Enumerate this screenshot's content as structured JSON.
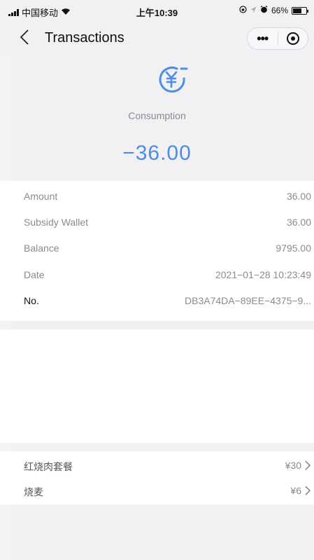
{
  "status_bar": {
    "carrier": "中国移动",
    "time": "上午10:39",
    "battery_percent": "66%",
    "icons": [
      "signal-icon",
      "wifi-icon",
      "lock-rotation-icon",
      "location-icon",
      "alarm-icon",
      "battery-icon"
    ]
  },
  "nav": {
    "title": "Transactions",
    "icons": [
      "back-chevron-icon",
      "more-dots-icon",
      "close-circle-icon"
    ]
  },
  "header": {
    "icon": "yuan-coin-icon",
    "type_label": "Consumption",
    "amount": "−36.00",
    "accent_color": "#4b8de8"
  },
  "details": [
    {
      "label": "Amount",
      "value": "36.00"
    },
    {
      "label": "Subsidy Wallet",
      "value": "36.00"
    },
    {
      "label": "Balance",
      "value": "9795.00"
    },
    {
      "label": "Date",
      "value": "2021−01−28 10:23:49"
    },
    {
      "label": "No.",
      "value": "DB3A74DA−89EE−4375−9..."
    }
  ],
  "items": [
    {
      "name": "红烧肉套餐",
      "price": "¥30"
    },
    {
      "name": "烧麦",
      "price": "¥6"
    }
  ]
}
